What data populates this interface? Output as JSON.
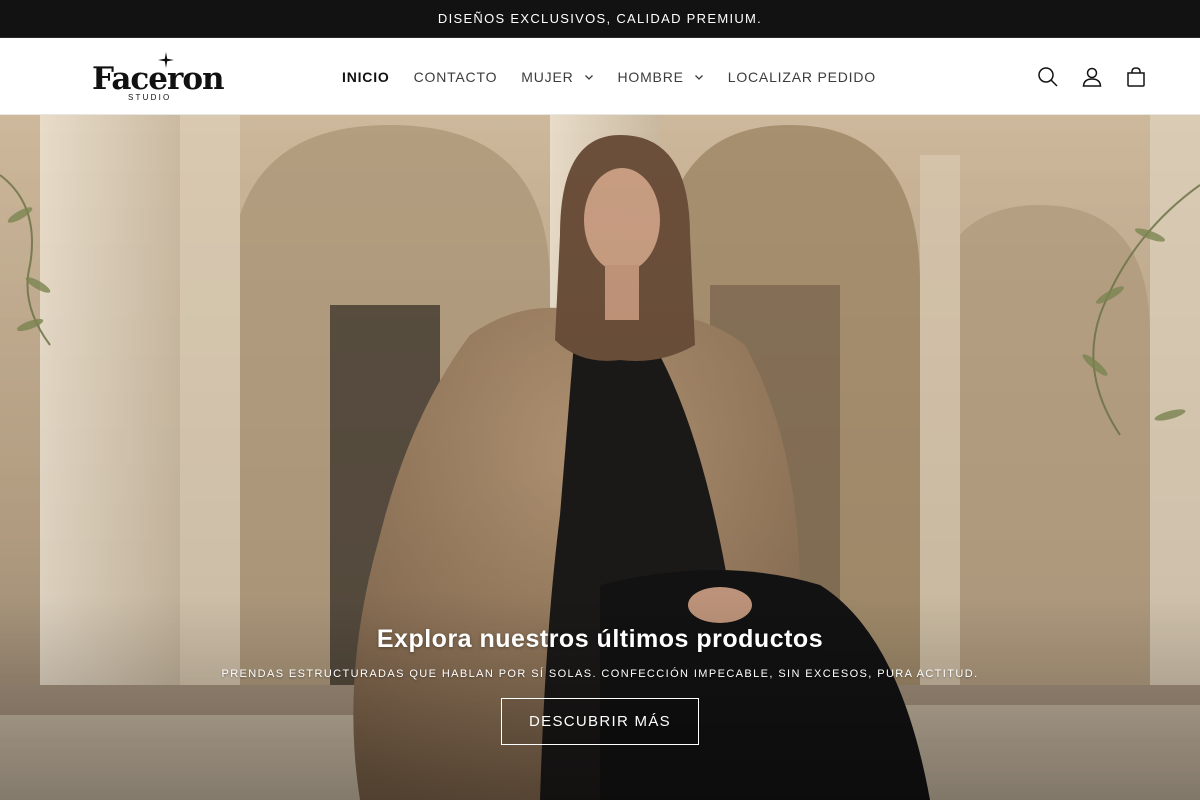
{
  "announcement": {
    "text": "DISEÑOS EXCLUSIVOS, CALIDAD PREMIUM."
  },
  "logo": {
    "name": "Faceron",
    "sub": "STUDIO"
  },
  "nav": {
    "items": [
      {
        "label": "INICIO",
        "active": true
      },
      {
        "label": "CONTACTO",
        "active": false
      },
      {
        "label": "MUJER",
        "active": false,
        "dropdown": true
      },
      {
        "label": "HOMBRE",
        "active": false,
        "dropdown": true
      },
      {
        "label": "LOCALIZAR PEDIDO",
        "active": false
      }
    ]
  },
  "header_icons": [
    "search-icon",
    "account-icon",
    "cart-icon"
  ],
  "hero": {
    "title": "Explora nuestros últimos productos",
    "subtitle": "PRENDAS ESTRUCTURADAS QUE HABLAN POR SÍ SOLAS. CONFECCIÓN IMPECABLE, SIN EXCESOS, PURA ACTITUD.",
    "cta_label": "DESCUBRIR MÁS"
  },
  "colors": {
    "announcement_bg": "#121212",
    "text": "#121212",
    "coat": "#a8896a",
    "wall": "#d9c7ad"
  }
}
